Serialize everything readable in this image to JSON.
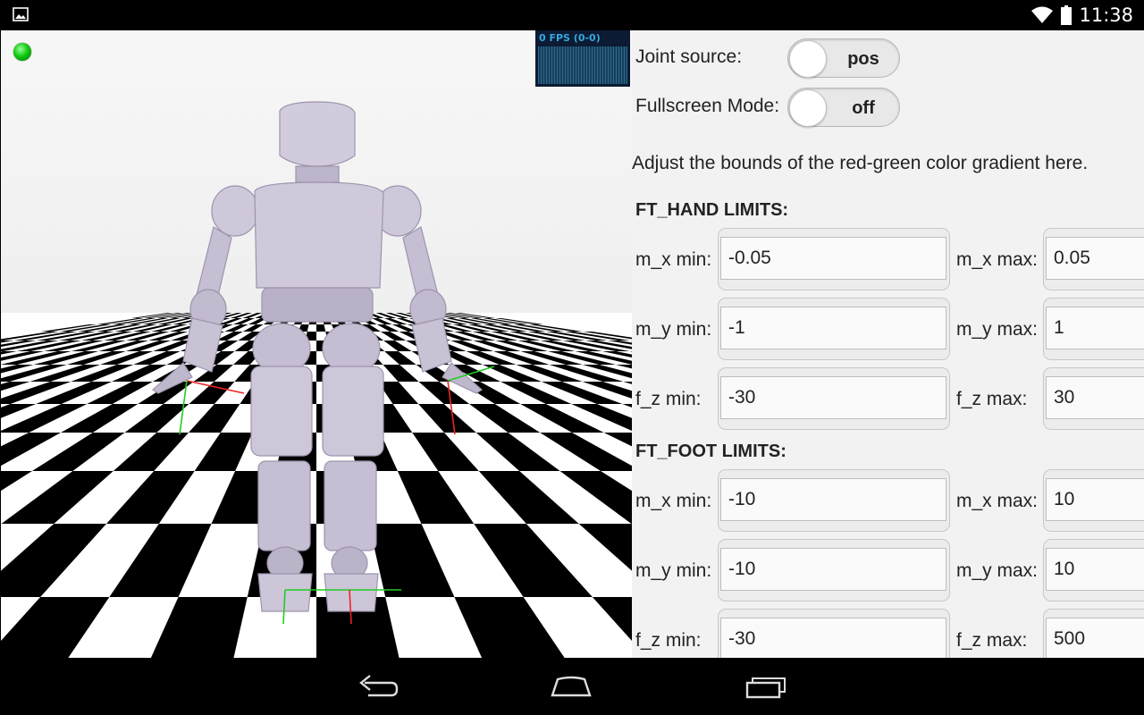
{
  "status_bar": {
    "time": "11:38",
    "icons": [
      "image-notification-icon",
      "wifi-icon",
      "battery-icon"
    ]
  },
  "viewport": {
    "fps_label": "0 FPS (0-0)",
    "indicator_color": "#22cc22",
    "robot_color": "#c8c0d4"
  },
  "panel": {
    "joint_source": {
      "label": "Joint source:",
      "value": "pos"
    },
    "fullscreen": {
      "label": "Fullscreen Mode:",
      "value": "off"
    },
    "description": "Adjust the bounds of the red-green color gradient here.",
    "hand_limits": {
      "title": "FT_HAND LIMITS:",
      "rows": [
        {
          "min_label": "m_x min:",
          "min_value": "-0.05",
          "max_label": "m_x max:",
          "max_value": "0.05"
        },
        {
          "min_label": "m_y min:",
          "min_value": "-1",
          "max_label": "m_y max:",
          "max_value": "1"
        },
        {
          "min_label": "f_z min:",
          "min_value": "-30",
          "max_label": "f_z max:",
          "max_value": "30"
        }
      ]
    },
    "foot_limits": {
      "title": "FT_FOOT LIMITS:",
      "rows": [
        {
          "min_label": "m_x min:",
          "min_value": "-10",
          "max_label": "m_x max:",
          "max_value": "10"
        },
        {
          "min_label": "m_y min:",
          "min_value": "-10",
          "max_label": "m_y max:",
          "max_value": "10"
        },
        {
          "min_label": "f_z min:",
          "min_value": "-30",
          "max_label": "f_z max:",
          "max_value": "500"
        }
      ]
    }
  },
  "nav_bar": {
    "buttons": [
      "back-icon",
      "home-icon",
      "recent-apps-icon"
    ]
  }
}
